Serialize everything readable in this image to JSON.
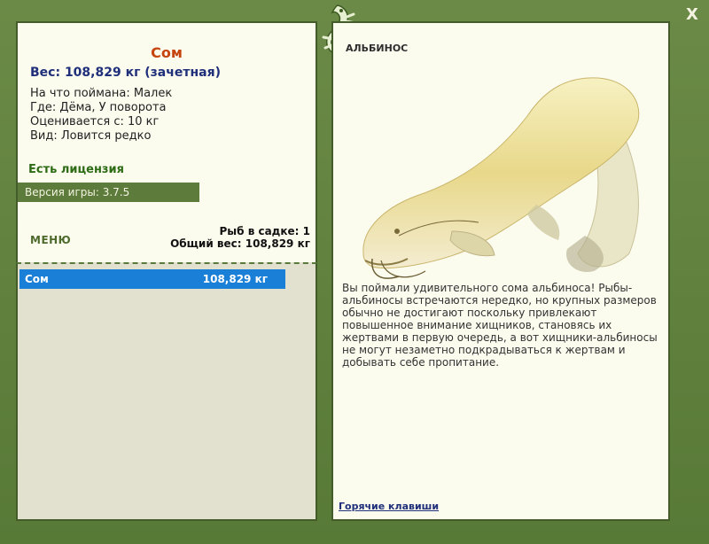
{
  "window": {
    "close_label": "X"
  },
  "fish": {
    "name": "Сом",
    "weight_line": "Вес: 108,829 кг (зачетная)",
    "bait_line": "На что поймана: Малек",
    "place_line": "Где: Дёма, У поворота",
    "valued_line": "Оценивается с: 10 кг",
    "species_line": "Вид: Ловится редко"
  },
  "license": "Есть лицензия",
  "version": "Версия игры: 3.7.5",
  "menu": "МЕНЮ",
  "keepnet": {
    "count_line": "Рыб в садке: 1",
    "total_line": "Общий вес: 108,829 кг"
  },
  "catch_list": [
    {
      "name": "Сом",
      "weight": "108,829 кг"
    }
  ],
  "detail": {
    "title": "АЛЬБИНОС",
    "description": "Вы поймали удивительного сома альбиноса! Рыбы-альбиносы встречаются нередко, но крупных размеров обычно не достигают поскольку привлекают повышенное внимание хищников, становясь их жертвами в первую очередь, а вот хищники-альбиносы не могут незаметно подкрадываться к жертвам и добывать себе пропитание.",
    "hotkeys": "Горячие клавиши"
  },
  "colors": {
    "frame": "#5a7a3c",
    "panel": "#fbfbee",
    "selected_row": "#1a7fd6",
    "fish_name": "#c54410",
    "weight": "#1f2f7a",
    "license": "#2d6b15"
  },
  "icons": [
    "close-icon",
    "lizard-logo-icon",
    "catfish-image"
  ]
}
